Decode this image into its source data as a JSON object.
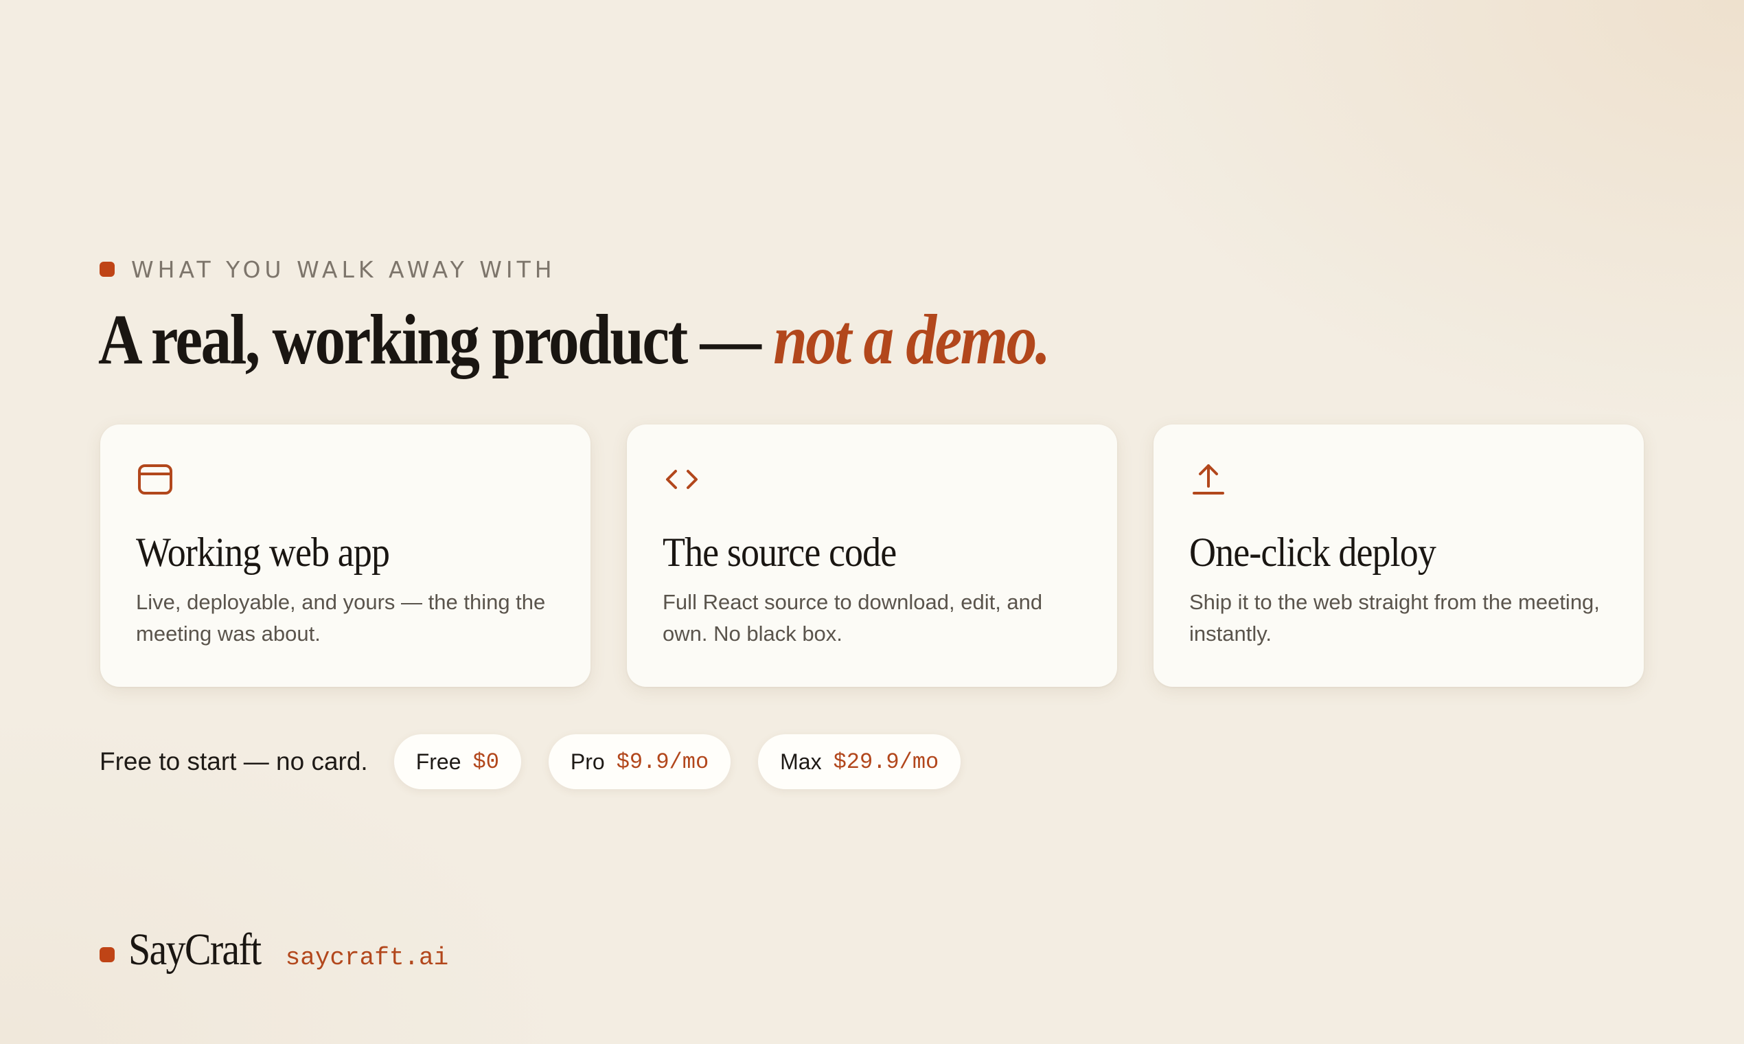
{
  "eyebrow": "WHAT YOU WALK AWAY WITH",
  "headline": {
    "main": "A real, working product — ",
    "accent": "not a demo."
  },
  "cards": [
    {
      "icon": "browser-window-icon",
      "title": "Working web app",
      "description": "Live, deployable, and yours — the thing the meeting was about."
    },
    {
      "icon": "code-brackets-icon",
      "title": "The source code",
      "description": "Full React source to download, edit, and own. No black box."
    },
    {
      "icon": "upload-arrow-icon",
      "title": "One-click deploy",
      "description": "Ship it to the web straight from the meeting, instantly."
    }
  ],
  "pricing": {
    "label": "Free to start — no card.",
    "plans": [
      {
        "name": "Free",
        "price": "$0"
      },
      {
        "name": "Pro",
        "price": "$9.9/mo"
      },
      {
        "name": "Max",
        "price": "$29.9/mo"
      }
    ]
  },
  "footer": {
    "brand": "SayCraft",
    "domain": "saycraft.ai"
  },
  "colors": {
    "accent": "#b2471c",
    "dot": "#bf4416",
    "background": "#f3ede2",
    "card": "#fcfbf6"
  }
}
